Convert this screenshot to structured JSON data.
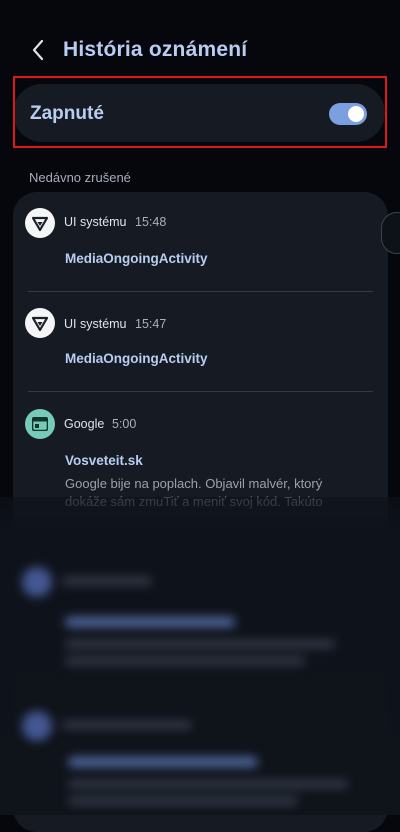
{
  "header": {
    "title": "História oznámení"
  },
  "toggle": {
    "label": "Zapnuté",
    "state": "on"
  },
  "section_label": "Nedávno zrušené",
  "notifications": [
    {
      "app": "UI systému",
      "time": "15:48",
      "title": "MediaOngoingActivity",
      "icon": "ui-system-icon"
    },
    {
      "app": "UI systému",
      "time": "15:47",
      "title": "MediaOngoingActivity",
      "icon": "ui-system-icon"
    },
    {
      "app": "Google",
      "time": "5:00",
      "title": "Vosveteit.sk",
      "text": "Google bije na poplach. Objavil malvér, ktorý dokáže sám zmuTiť a meniť svoj kód. Takúto",
      "icon": "google-calendar-icon"
    }
  ],
  "colors": {
    "accent": "#b9cdf2",
    "switch_on": "#7c9fe0",
    "highlight": "#e0161e",
    "card_bg": "#161b23",
    "page_bg": "#05070d"
  }
}
